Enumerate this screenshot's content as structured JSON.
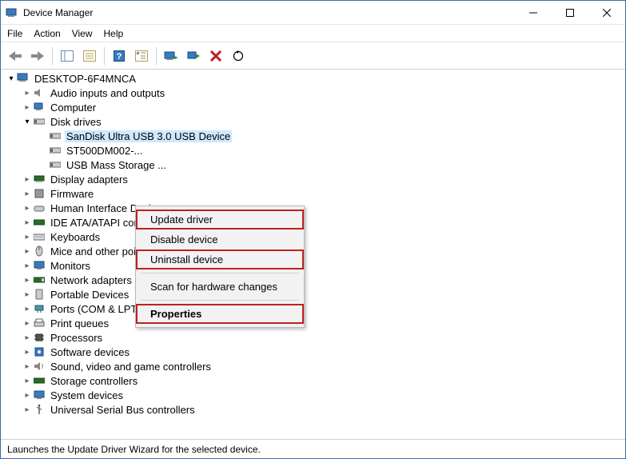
{
  "title": "Device Manager",
  "menu": {
    "file": "File",
    "action": "Action",
    "view": "View",
    "help": "Help"
  },
  "toolbar": {
    "back": "◄",
    "forward": "►",
    "view_icon": "view",
    "props_icon": "props",
    "help_icon": "?",
    "list_icon": "list",
    "monitor_icon": "mon",
    "scan_icon": "scan",
    "delete_icon": "×",
    "update_icon": "⟳"
  },
  "root": "DESKTOP-6F4MNCA",
  "disk_drives": {
    "label": "Disk drives",
    "children": {
      "sandisk": "SanDisk Ultra USB 3.0 USB Device",
      "st500": "ST500DM002-...",
      "usbmass": "USB Mass Storage ..."
    }
  },
  "cats": {
    "audio": "Audio inputs and outputs",
    "computer": "Computer",
    "display_adapters": "Display adapters",
    "firmware": "Firmware",
    "hid": "Human Interface Devices",
    "ide": "IDE ATA/ATAPI controllers",
    "keyboards": "Keyboards",
    "mice": "Mice and other pointing devices",
    "monitors": "Monitors",
    "network": "Network adapters",
    "portable": "Portable Devices",
    "ports": "Ports (COM & LPT)",
    "printq": "Print queues",
    "processors": "Processors",
    "software": "Software devices",
    "sound": "Sound, video and game controllers",
    "storage": "Storage controllers",
    "system": "System devices",
    "usb": "Universal Serial Bus controllers"
  },
  "context_menu": {
    "update": "Update driver",
    "disable": "Disable device",
    "uninstall": "Uninstall device",
    "scan": "Scan for hardware changes",
    "properties": "Properties"
  },
  "status": "Launches the Update Driver Wizard for the selected device."
}
